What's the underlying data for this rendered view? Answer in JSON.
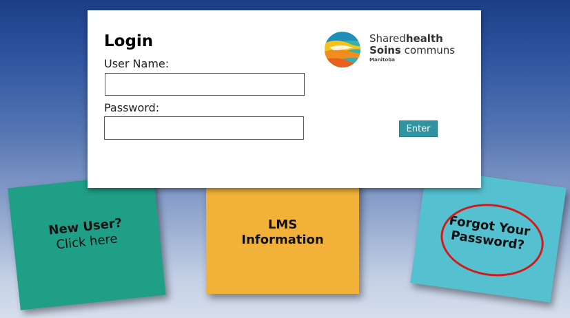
{
  "login": {
    "title": "Login",
    "username_label": "User Name:",
    "username_value": "",
    "password_label": "Password:",
    "password_value": "",
    "enter_label": "Enter"
  },
  "logo": {
    "line1_normal": "Shared",
    "line1_bold": "health",
    "line2_bold": "Soins",
    "line2_normal": "communs",
    "line3": "Manitoba",
    "icon": "shared-health-logo-icon"
  },
  "tiles": {
    "new_user": {
      "title": "New User?",
      "subtitle": "Click here",
      "color": "#1fa086"
    },
    "lms": {
      "line1": "LMS",
      "line2": "Information",
      "color": "#f2b23a"
    },
    "forgot": {
      "line1": "Forgot Your",
      "line2": "Password?",
      "color": "#55c0d0",
      "highlight_color": "#d61818"
    }
  },
  "colors": {
    "enter_button": "#2e94a1",
    "background_top": "#1b3e86",
    "background_bottom": "#d6deec"
  }
}
